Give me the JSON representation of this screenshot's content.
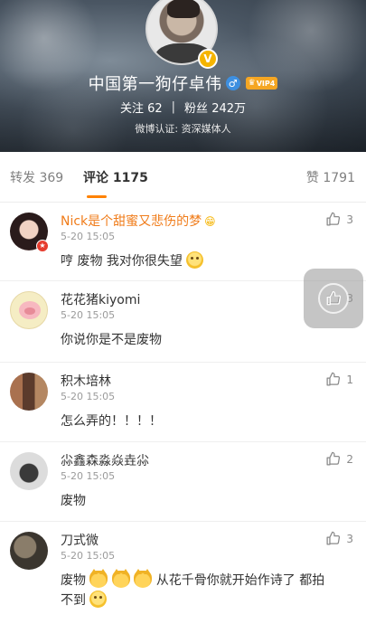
{
  "profile": {
    "name": "中国第一狗仔卓伟",
    "verified_badge": "V",
    "gender_icon": "male-icon",
    "vip_label": "VIP4",
    "following_label": "关注",
    "following_count": "62",
    "followers_label": "粉丝",
    "followers_count": "242万",
    "separator": "|",
    "verification": "微博认证: 资深媒体人"
  },
  "tabs": {
    "repost": "转发 369",
    "comments": "评论 1175",
    "likes": "赞 1791",
    "accent_color": "#ff8200"
  },
  "comments": [
    {
      "user": "Nick是个甜蜜又悲伤的梦",
      "name_icon": "grinning-emoji-icon",
      "time": "5-20 15:05",
      "text": "哼 废物 我对你很失望",
      "text_emoji": "smile-emoji-icon",
      "likes": "3"
    },
    {
      "user": "花花猪kiyomi",
      "time": "5-20 15:05",
      "text": "你说你是不是废物",
      "likes": "3"
    },
    {
      "user": "积木培林",
      "time": "5-20 15:05",
      "text": "怎么弄的！！！！",
      "likes": "1"
    },
    {
      "user": "尛鑫森淼焱垚尛",
      "time": "5-20 15:05",
      "text": "废物",
      "likes": "2"
    },
    {
      "user": "刀式微",
      "time": "5-20 15:05",
      "text_a": "废物",
      "text_b": "从花千骨你就开始作诗了 都拍",
      "text_c": "不到",
      "text_emoji": "cat-emoji-icon",
      "likes": "3"
    }
  ]
}
